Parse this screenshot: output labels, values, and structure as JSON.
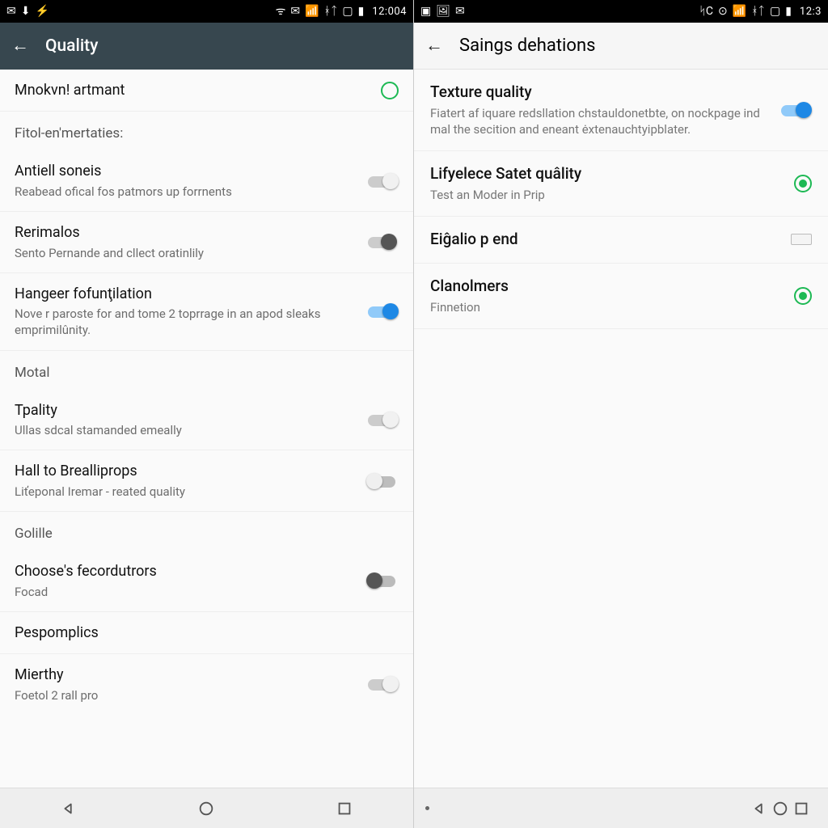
{
  "left": {
    "statusbar": {
      "left_icons": [
        "✉",
        "⬇",
        "⚡"
      ],
      "right_icons": [
        "ᯤ",
        "✉",
        "📶",
        "ᚼᛏ",
        "▢",
        "▮"
      ],
      "clock": "12:004"
    },
    "appbar": {
      "title": "Quality"
    },
    "rows": [
      {
        "kind": "switch_radio",
        "title": "Mnokvn! artmant",
        "control": "radio-hollow"
      },
      {
        "kind": "header",
        "title": "Fitol-en'mertaties:"
      },
      {
        "kind": "switch",
        "title": "Antiell soneis",
        "sub": "Reabead ofical fos patmors up forrnents",
        "state": "on-grey"
      },
      {
        "kind": "switch",
        "title": "Rerimalos",
        "sub": "Sento Pernande and cllect oratinlily",
        "state": "mid"
      },
      {
        "kind": "switch",
        "title": "Hangeer fofunţilation",
        "sub": "Nove r paroste for and tome 2 toprrage in an apod sleaks emprimilûnity.",
        "state": "on"
      },
      {
        "kind": "header",
        "title": "Motal"
      },
      {
        "kind": "switch",
        "title": "Tpality",
        "sub": "Ullas sdcal stamanded emeally",
        "state": "on-grey"
      },
      {
        "kind": "switch",
        "title": "Hall to Brealliprops",
        "sub": "Liťeponal Iremar - reated quality",
        "state": "off"
      },
      {
        "kind": "header",
        "title": "Golille"
      },
      {
        "kind": "switch",
        "title": "Choose's fecordutrors",
        "sub": "Focad",
        "state": "off-dark"
      },
      {
        "kind": "simple",
        "title": "Pespomplics"
      },
      {
        "kind": "switch",
        "title": "Mierthy",
        "sub": "Foetol 2 rall pro",
        "state": "on-grey"
      }
    ]
  },
  "right": {
    "statusbar": {
      "left_icons": [
        "▣",
        "🖼",
        "✉"
      ],
      "right_icons": [
        "ᛋC",
        "⊙",
        "📶",
        "ᚼᛏ",
        "▢",
        "▮"
      ],
      "clock": "12:3"
    },
    "appbar": {
      "title": "Saings dehations"
    },
    "rows": [
      {
        "kind": "switch",
        "title": "Texture quality",
        "sub": "Fiatert af iquare redsllation chstauldonetbte, on nockpage ind mal the secition and eneant ėxtenauchtyipblater.",
        "state": "on"
      },
      {
        "kind": "radio",
        "title": "Lifyelece Satet quâlity",
        "sub": "Test an Moder in Prip",
        "state": "checked"
      },
      {
        "kind": "rect",
        "title": "Eiĝalio p end"
      },
      {
        "kind": "radio",
        "title": "Clanolmers",
        "sub": "Finnetion",
        "state": "checked"
      }
    ]
  }
}
